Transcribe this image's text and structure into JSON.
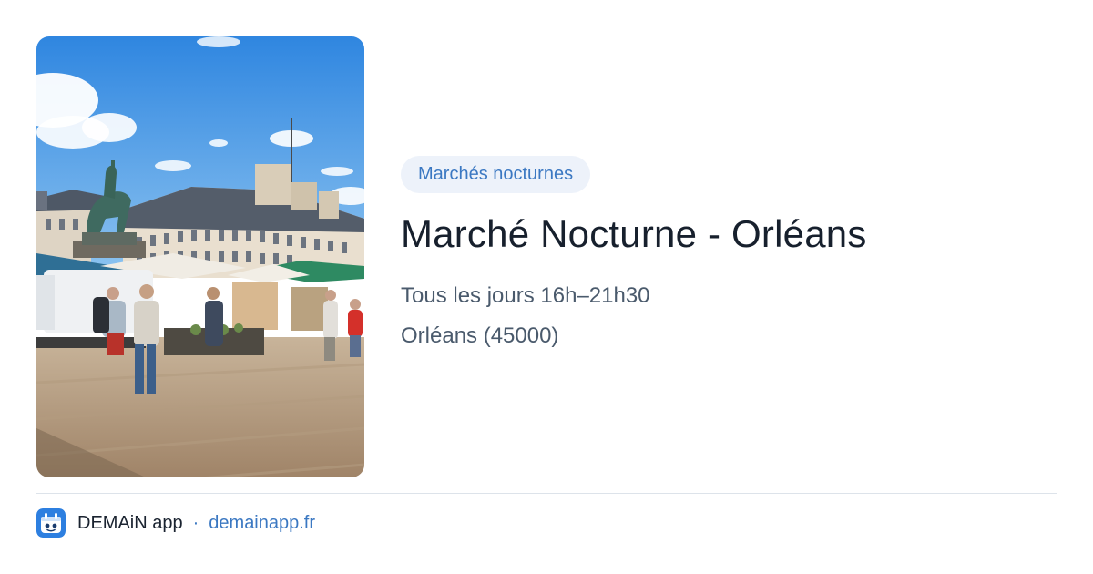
{
  "card": {
    "image_alt": "Place du Martroi, Orléans, market stalls and statue of Joan of Arc",
    "category": "Marchés nocturnes",
    "title": "Marché Nocturne - Orléans",
    "schedule": "Tous les jours 16h–21h30",
    "location": "Orléans (45000)"
  },
  "footer": {
    "app_name": "DEMAiN app",
    "separator": "·",
    "link": "demainapp.fr"
  },
  "colors": {
    "accent": "#3b78c2",
    "tag_bg": "#edf2fa",
    "title": "#17202d",
    "muted": "#4a5a6c",
    "divider": "#dde3ea"
  }
}
